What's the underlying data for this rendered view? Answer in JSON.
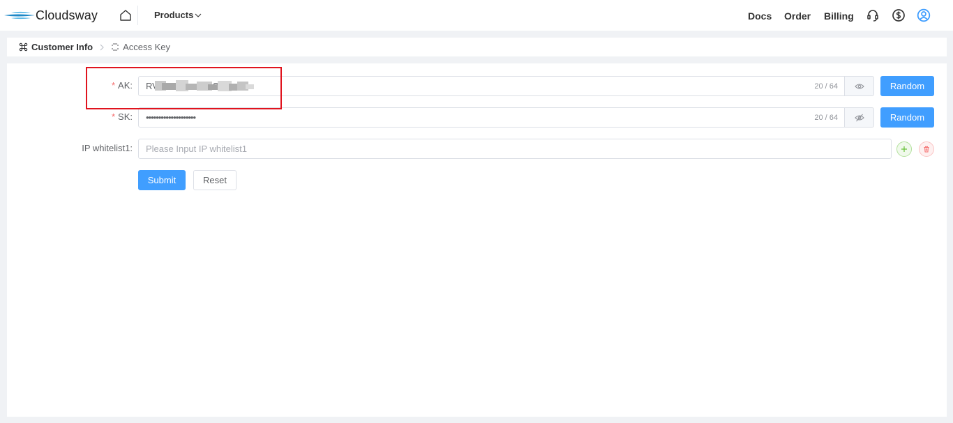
{
  "header": {
    "brand": "Cloudsway",
    "products_label": "Products",
    "nav": [
      "Docs",
      "Order",
      "Billing"
    ],
    "icons": [
      "headset-icon",
      "dollar-icon",
      "user-icon"
    ],
    "accent": "#409eff"
  },
  "breadcrumb": {
    "parent": "Customer Info",
    "current": "Access Key"
  },
  "form": {
    "ak": {
      "label": "AK:",
      "value": "RV•••••••••••••••••C",
      "counter": "20 / 64",
      "random_label": "Random"
    },
    "sk": {
      "label": "SK:",
      "value": "••••••••••••••••••••",
      "counter": "20 / 64",
      "random_label": "Random"
    },
    "ip": {
      "label": "IP whitelist1:",
      "placeholder": "Please Input IP whitelist1"
    },
    "required_mark": "*",
    "submit_label": "Submit",
    "reset_label": "Reset"
  }
}
